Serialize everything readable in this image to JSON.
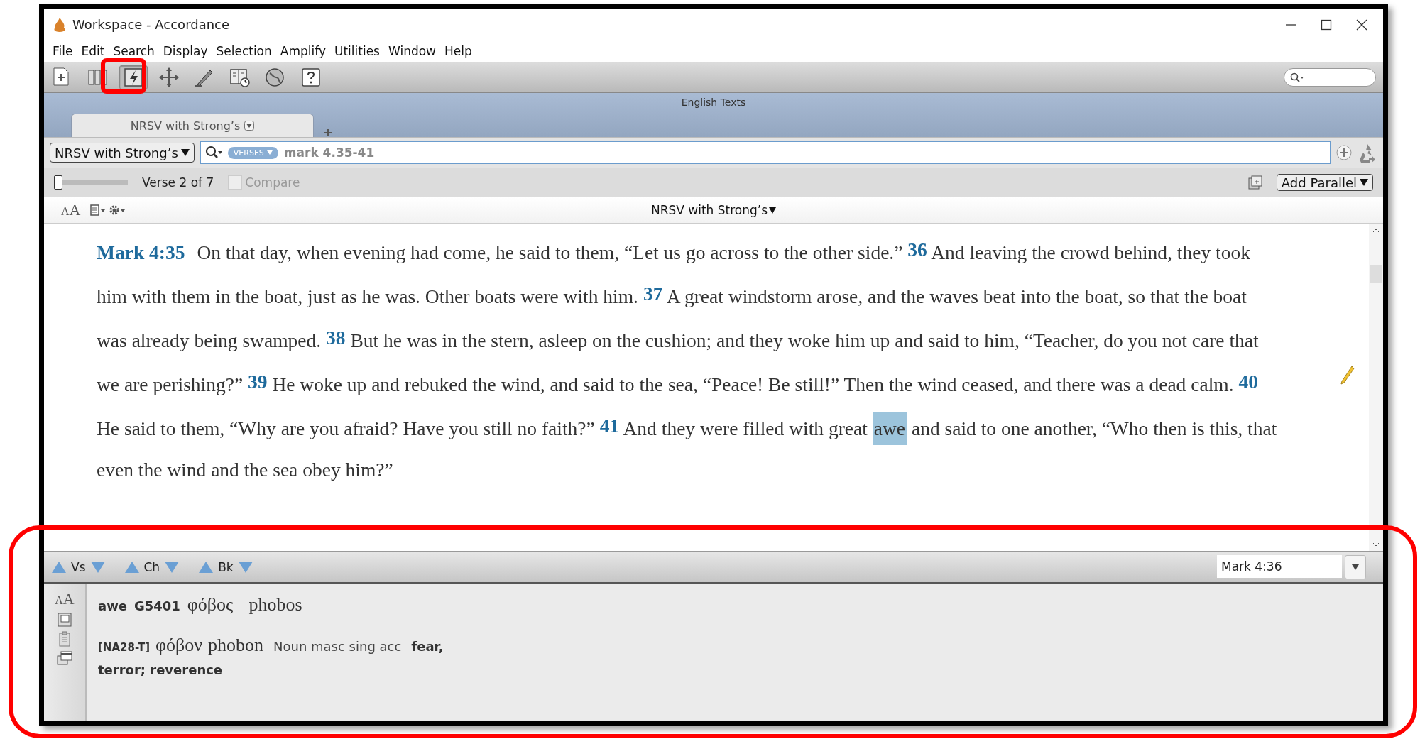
{
  "window": {
    "title": "Workspace - Accordance"
  },
  "menu": [
    "File",
    "Edit",
    "Search",
    "Display",
    "Selection",
    "Amplify",
    "Utilities",
    "Window",
    "Help"
  ],
  "toolbar": [
    {
      "kind": "new",
      "selected": false
    },
    {
      "kind": "library",
      "selected": false
    },
    {
      "kind": "highlight",
      "selected": true
    },
    {
      "kind": "move",
      "selected": false
    },
    {
      "kind": "pen",
      "selected": false
    },
    {
      "kind": "timeline",
      "selected": false
    },
    {
      "kind": "globe",
      "selected": false
    },
    {
      "kind": "help",
      "selected": false
    }
  ],
  "zone_title": "English Texts",
  "tabs": [
    {
      "label": "NRSV with Strong’s",
      "selected": true
    }
  ],
  "search_row": {
    "module": "NRSV with Strong’s",
    "search_type": "VERSES",
    "query": "mark 4.35-41"
  },
  "verse_row": {
    "slider": {
      "level": 0
    },
    "position": "Verse 2 of 7",
    "compare": {
      "label": "Compare",
      "checked": false
    },
    "add_parallel": "Add Parallel"
  },
  "pane": {
    "font_button": "AA",
    "title": "NRSV with Strong’s"
  },
  "passage": [
    [
      {
        "kind": "reference",
        "text": "Mark 4:35"
      },
      {
        "kind": "text",
        "text": "On that day, when evening had come, he said to them, “Let us go across to the other side.”"
      },
      {
        "kind": "verse",
        "text": "36"
      },
      {
        "kind": "text",
        "text": "And leaving the crowd behind, they took"
      }
    ],
    [
      {
        "kind": "text",
        "text": "him with them in the boat, just as he was. Other boats were with him."
      },
      {
        "kind": "verse",
        "text": "37"
      },
      {
        "kind": "text",
        "text": "A great windstorm arose, and the waves beat into the boat, so that the boat"
      }
    ],
    [
      {
        "kind": "text",
        "text": "was already being swamped."
      },
      {
        "kind": "verse",
        "text": "38"
      },
      {
        "kind": "text",
        "text": "But he was in the stern, asleep on the cushion; and they woke him up and said to him, “Teacher, do you not care that"
      }
    ],
    [
      {
        "kind": "text",
        "text": "we are perishing?”"
      },
      {
        "kind": "verse",
        "text": "39"
      },
      {
        "kind": "text",
        "text": "He woke up and rebuked the wind, and said to the sea, “Peace! Be still!” Then the wind ceased, and there was a dead calm."
      },
      {
        "kind": "verse",
        "text": "40"
      }
    ],
    [
      {
        "kind": "text",
        "text": "He said to them, “Why are you afraid? Have you still no faith?”"
      },
      {
        "kind": "verse",
        "text": "41"
      },
      {
        "kind": "text",
        "text": "And they were filled with great"
      },
      {
        "kind": "highlight",
        "text": "awe"
      },
      {
        "kind": "text",
        "text": "and said to one another, “Who then is this, that"
      }
    ],
    [
      {
        "kind": "text",
        "text": "even the wind and the sea obey him?”"
      }
    ]
  ],
  "navigator": [
    {
      "label": "Vs"
    },
    {
      "label": "Ch"
    },
    {
      "label": "Bk"
    }
  ],
  "reference_field": "Mark 4:36",
  "details": {
    "font_button": "AA",
    "word": "awe",
    "strongs": "G5401",
    "lemma": "φόβος",
    "transliteration": "phobos",
    "source": "[NA28-T]",
    "form": "φόβον",
    "form_transliteration": "phobon",
    "parsing": "Noun masc sing acc",
    "gloss": [
      "fear,",
      "terror; reverence"
    ]
  }
}
